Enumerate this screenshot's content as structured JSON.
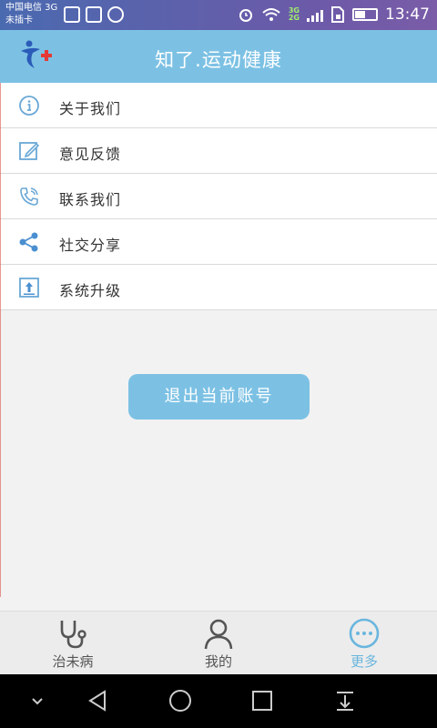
{
  "status_bar": {
    "carrier_line1": "中国电信 3G",
    "carrier_line2": "未插卡",
    "time": "13:47",
    "net_top": "3G",
    "net_bottom": "2G"
  },
  "header": {
    "title": "知了.运动健康",
    "logo_icon": "app-logo-icon"
  },
  "menu": [
    {
      "label": "关于我们",
      "icon": "info-icon"
    },
    {
      "label": "意见反馈",
      "icon": "edit-icon"
    },
    {
      "label": "联系我们",
      "icon": "phone-icon"
    },
    {
      "label": "社交分享",
      "icon": "share-icon"
    },
    {
      "label": "系统升级",
      "icon": "upgrade-icon"
    }
  ],
  "logout_label": "退出当前账号",
  "tabs": [
    {
      "label": "治未病",
      "icon": "stethoscope-icon",
      "active": false
    },
    {
      "label": "我的",
      "icon": "user-icon",
      "active": false
    },
    {
      "label": "更多",
      "icon": "more-icon",
      "active": true
    }
  ],
  "colors": {
    "accent": "#7cc1e4",
    "active_tab": "#6ab6de"
  }
}
